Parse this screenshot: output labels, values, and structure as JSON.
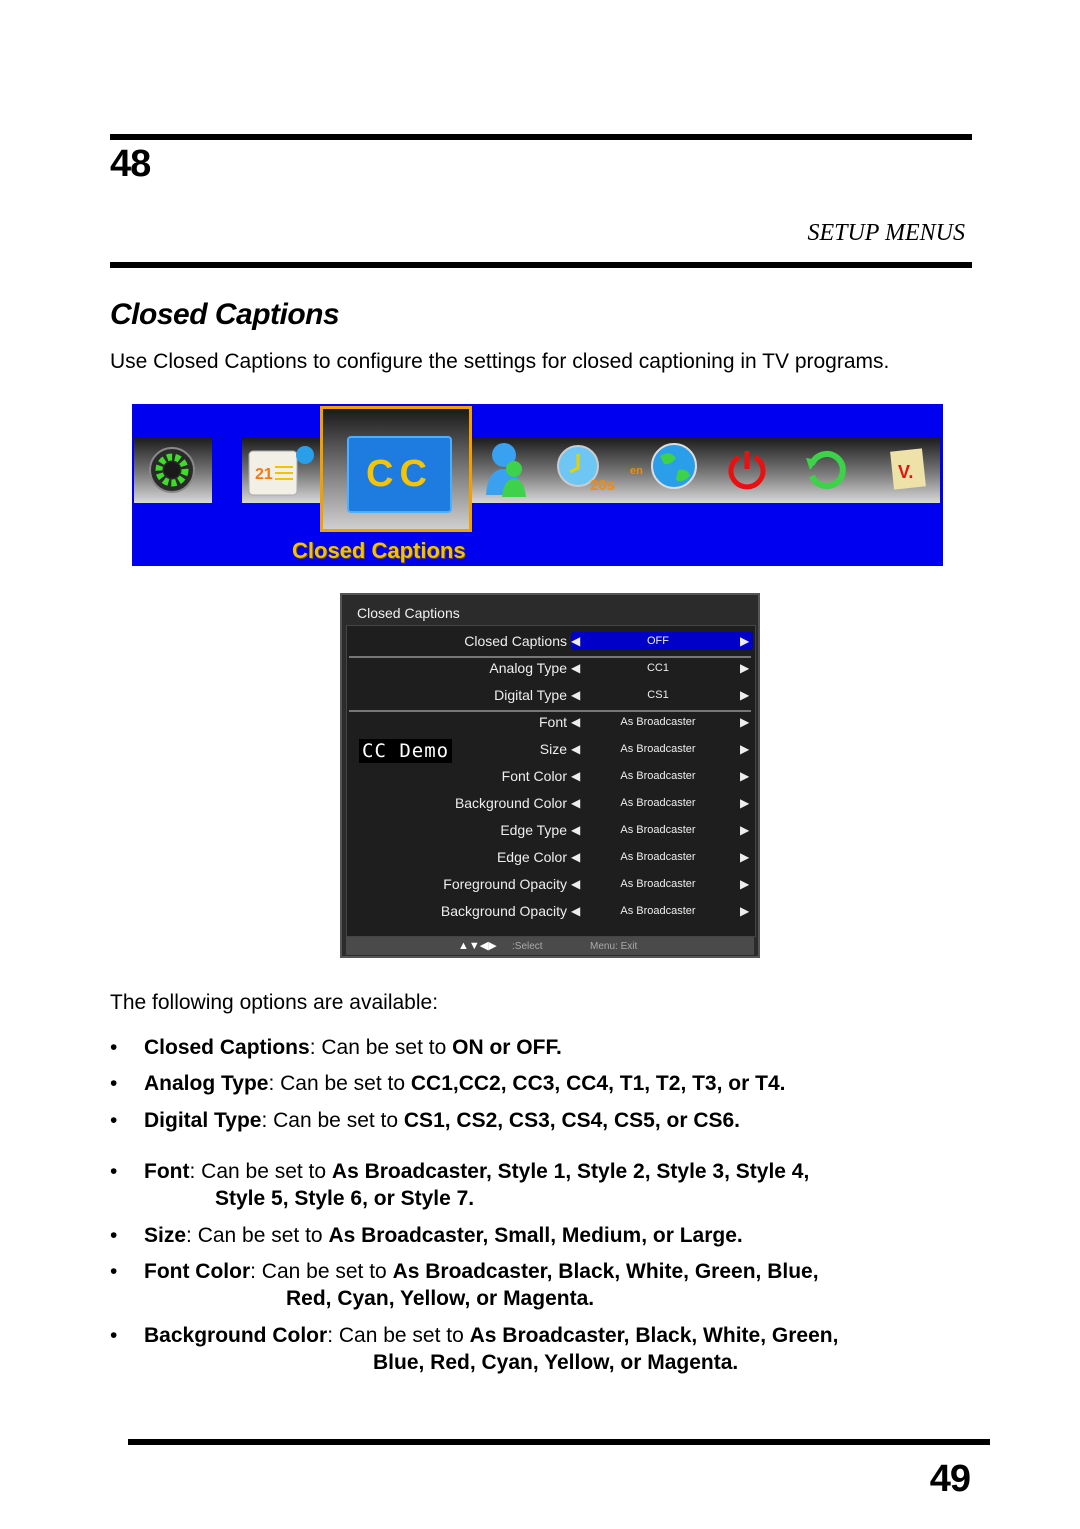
{
  "header": {
    "page_number": "48",
    "section": "SETUP MENUS"
  },
  "heading": "Closed Captions",
  "intro": "Use Closed Captions to configure the settings for closed captioning in TV programs.",
  "banner": {
    "background_color": "#0000f0",
    "selected_label": "CC",
    "caption": "Closed Captions",
    "icons": [
      "gear-icon",
      "calendar-clock-icon",
      "closed-captions-icon",
      "user-icon",
      "timer-icon",
      "globe-language-icon",
      "power-icon",
      "reset-icon",
      "version-note-icon"
    ],
    "timer_text": "20s",
    "language_text": "en",
    "calendar_text": "21",
    "version_text": "V."
  },
  "osd": {
    "title": "Closed Captions",
    "highlight_color": "#0000c8",
    "demo_text": "CC  Demo",
    "rows": [
      {
        "label": "Closed Captions",
        "value": "OFF",
        "selected": true
      },
      {
        "label": "Analog Type",
        "value": "CC1"
      },
      {
        "label": "Digital Type",
        "value": "CS1"
      },
      {
        "label": "Font",
        "value": "As Broadcaster"
      },
      {
        "label": "Size",
        "value": "As Broadcaster"
      },
      {
        "label": "Font Color",
        "value": "As Broadcaster"
      },
      {
        "label": "Background Color",
        "value": "As Broadcaster"
      },
      {
        "label": "Edge Type",
        "value": "As Broadcaster"
      },
      {
        "label": "Edge Color",
        "value": "As Broadcaster"
      },
      {
        "label": "Foreground Opacity",
        "value": "As Broadcaster"
      },
      {
        "label": "Background Opacity",
        "value": "As Broadcaster"
      }
    ],
    "footer": {
      "nav_glyphs": "▲▼◀▶",
      "select": ":Select",
      "exit": "Menu: Exit"
    }
  },
  "available_intro": "The following options are available:",
  "options": [
    {
      "name": "Closed Captions",
      "text": ": Can be set to ",
      "values": "ON or OFF."
    },
    {
      "name": "Analog Type",
      "text": ": Can be set to ",
      "values": "CC1,CC2, CC3, CC4, T1, T2, T3, or T4."
    },
    {
      "name": "Digital Type",
      "text": ": Can be set to ",
      "values": "CS1, CS2, CS3, CS4, CS5, or CS6."
    },
    {
      "name": "Font",
      "text": ": Can be set to ",
      "values": "As Broadcaster, Style 1, Style 2, Style 3, Style 4,",
      "cont": "Style 5, Style 6, or Style 7."
    },
    {
      "name": "Size",
      "text": ": Can be set to ",
      "values": "As Broadcaster, Small, Medium, or Large."
    },
    {
      "name": "Font Color",
      "text": ": Can be set to ",
      "values": "As Broadcaster, Black, White, Green, Blue,",
      "cont": "Red, Cyan, Yellow, or Magenta."
    },
    {
      "name": "Background Color",
      "text": ": Can be set to ",
      "values": "As Broadcaster, Black, White, Green,",
      "cont": "Blue, Red, Cyan, Yellow, or Magenta."
    }
  ],
  "footer": {
    "page_number": "49"
  }
}
